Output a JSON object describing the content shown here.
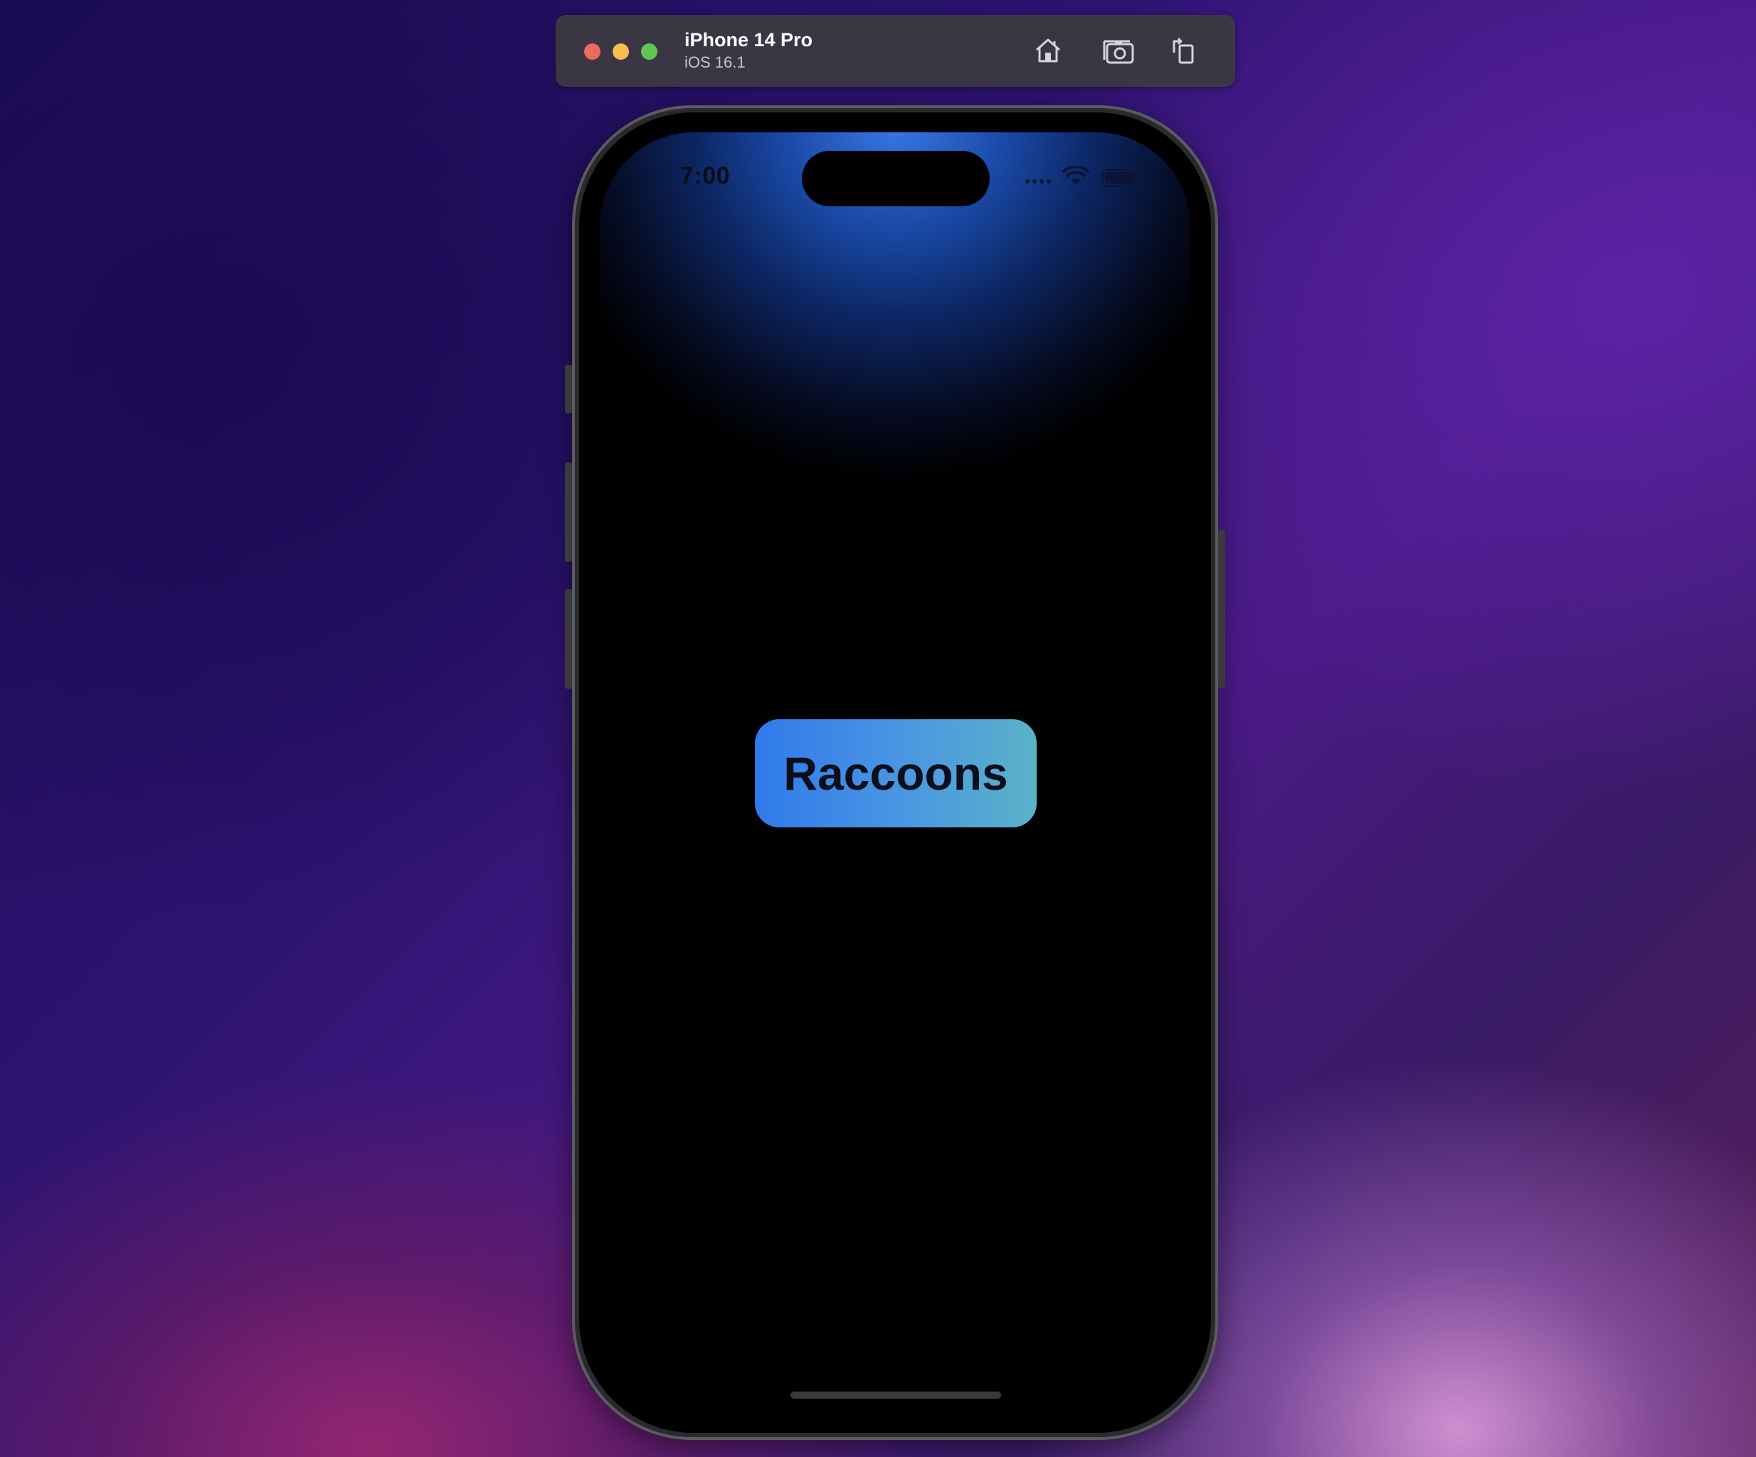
{
  "window": {
    "device_name": "iPhone 14 Pro",
    "os_version": "iOS 16.1",
    "toolbar": {
      "home_icon": "home-icon",
      "screenshot_icon": "screenshot-icon",
      "rotate_icon": "rotate-icon"
    }
  },
  "status_bar": {
    "time": "7:00",
    "signal_icon": "cellular-signal-icon",
    "wifi_icon": "wifi-icon",
    "battery_icon": "battery-icon"
  },
  "content": {
    "button_label": "Raccoons"
  },
  "colors": {
    "button_gradient_start": "#2f7aea",
    "button_gradient_end": "#5ab3c8",
    "screen_glow": "#3a79e8"
  }
}
